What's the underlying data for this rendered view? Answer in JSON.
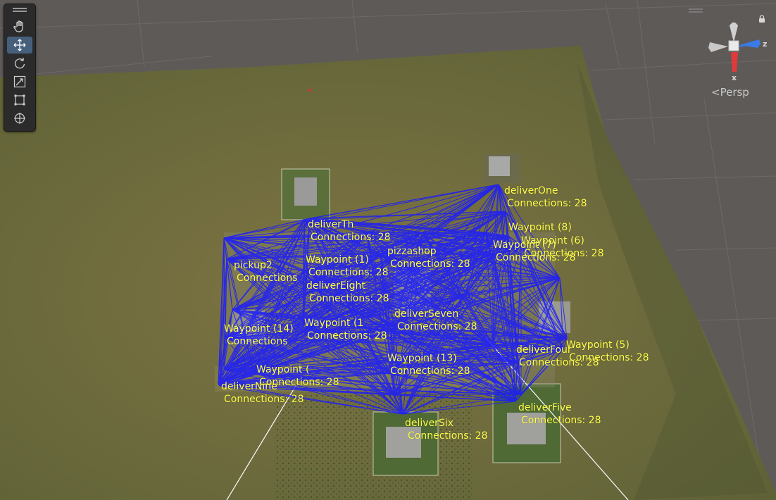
{
  "scene_view": {
    "camera_mode": "Persp",
    "gizmo_axes": [
      "x",
      "z"
    ],
    "toolbar": {
      "tools": [
        {
          "name": "hand-tool",
          "icon": "hand-icon",
          "active": false
        },
        {
          "name": "move-tool",
          "icon": "move-icon",
          "active": true
        },
        {
          "name": "rotate-tool",
          "icon": "rotate-icon",
          "active": false
        },
        {
          "name": "scale-tool",
          "icon": "scale-icon",
          "active": false
        },
        {
          "name": "rect-tool",
          "icon": "rect-transform-icon",
          "active": false
        },
        {
          "name": "transform-tool",
          "icon": "transform-icon",
          "active": false
        }
      ]
    },
    "colors": {
      "terrain": "#6f6a3e",
      "grid_background": "#5e5a58",
      "connection_lines": "#1a1aff",
      "labels": "#ffff4a",
      "axis_x": "#e03a3a",
      "axis_z": "#3a7be8"
    }
  },
  "waypoints": [
    {
      "id": "deliverOne",
      "name": "deliverOne",
      "connections": "Connections: 28"
    },
    {
      "id": "deliverThree",
      "name": "deliverTh",
      "connections": "Connections: 28"
    },
    {
      "id": "wp8",
      "name": "Waypoint (8)",
      "connections": ""
    },
    {
      "id": "wp_overlap_a",
      "name": "Waypoint (6)",
      "connections": "Connections: 28"
    },
    {
      "id": "wp_overlap_b",
      "name": "Waypoint (7)",
      "connections": "Connections: 28"
    },
    {
      "id": "pizzashop",
      "name": "pizzashop",
      "connections": "Connections: 28"
    },
    {
      "id": "pickup2",
      "name": "pickup2",
      "connections": "Connections"
    },
    {
      "id": "waypoint1",
      "name": "Waypoint (1)",
      "connections": "Connections: 28"
    },
    {
      "id": "deliverEight",
      "name": "deliverEight",
      "connections": "Connections: 28"
    },
    {
      "id": "deliverSeven",
      "name": "deliverSeven",
      "connections": "Connections: 28"
    },
    {
      "id": "wp14",
      "name": "Waypoint (14)",
      "connections": "Connections"
    },
    {
      "id": "wp_mid",
      "name": "Waypoint (1",
      "connections": "Connections: 28"
    },
    {
      "id": "wp5",
      "name": "Waypoint (5)",
      "connections": "Connections: 28"
    },
    {
      "id": "deliverFour",
      "name": "deliverFour",
      "connections": "Connections: 28"
    },
    {
      "id": "wp13",
      "name": "Waypoint (13)",
      "connections": "Connections: 28"
    },
    {
      "id": "wp_low",
      "name": "Waypoint (",
      "connections": "Connections: 28"
    },
    {
      "id": "deliverNine",
      "name": "deliverNine",
      "connections": "Connections: 28"
    },
    {
      "id": "deliverFive",
      "name": "deliverFive",
      "connections": "Connections: 28"
    },
    {
      "id": "deliverSix",
      "name": "deliverSix",
      "connections": "Connections: 28"
    }
  ]
}
